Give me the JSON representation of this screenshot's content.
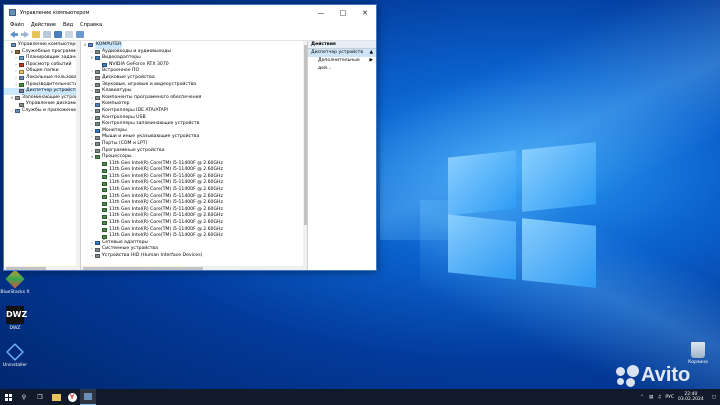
{
  "window": {
    "title": "Управление компьютером",
    "menu": [
      "Файл",
      "Действие",
      "Вид",
      "Справка"
    ]
  },
  "left_tree": [
    {
      "label": "Управление компьютером (л",
      "indent": 0,
      "twisty": "",
      "icon": "computer-mgmt-icon",
      "color": "#6a8fb8"
    },
    {
      "label": "Служебные программы",
      "indent": 1,
      "twisty": "v",
      "icon": "tools-icon",
      "color": "#8a6a48"
    },
    {
      "label": "Планировщик заданий",
      "indent": 2,
      "twisty": ">",
      "icon": "scheduler-icon",
      "color": "#5a9bd0"
    },
    {
      "label": "Просмотр событий",
      "indent": 2,
      "twisty": ">",
      "icon": "event-viewer-icon",
      "color": "#c0392b"
    },
    {
      "label": "Общие папки",
      "indent": 2,
      "twisty": ">",
      "icon": "folder-icon",
      "color": "#e8c25a"
    },
    {
      "label": "Локальные пользоват",
      "indent": 2,
      "twisty": ">",
      "icon": "users-icon",
      "color": "#6a8fb8"
    },
    {
      "label": "Производительность",
      "indent": 2,
      "twisty": ">",
      "icon": "performance-icon",
      "color": "#4b8f3a"
    },
    {
      "label": "Диспетчер устройств",
      "indent": 2,
      "twisty": "",
      "icon": "device-manager-icon",
      "color": "#7a7a9a",
      "selected": true
    },
    {
      "label": "Запоминающие устройст",
      "indent": 1,
      "twisty": "v",
      "icon": "storage-icon",
      "color": "#8c8c8c"
    },
    {
      "label": "Управление дисками",
      "indent": 2,
      "twisty": "",
      "icon": "disk-icon",
      "color": "#8c8c8c"
    },
    {
      "label": "Службы и приложения",
      "indent": 1,
      "twisty": ">",
      "icon": "services-icon",
      "color": "#6a8fb8"
    }
  ],
  "device_tree": [
    {
      "label": "KOMPUTER",
      "indent": 0,
      "twisty": "v",
      "icon": "computer-icon",
      "color": "#5b85c0",
      "highlight": true
    },
    {
      "label": "Аудиовходы и аудиовыходы",
      "indent": 1,
      "twisty": ">",
      "icon": "audio-icon",
      "color": "#7f8c8d"
    },
    {
      "label": "Видеоадаптеры",
      "indent": 1,
      "twisty": "v",
      "icon": "display-adapter-icon",
      "color": "#3d7dbf"
    },
    {
      "label": "NVIDIA GeForce RTX 3070",
      "indent": 2,
      "twisty": "",
      "icon": "display-adapter-icon",
      "color": "#3d7dbf"
    },
    {
      "label": "Встроенное ПО",
      "indent": 1,
      "twisty": ">",
      "icon": "firmware-icon",
      "color": "#7f8c8d"
    },
    {
      "label": "Дисковые устройства",
      "indent": 1,
      "twisty": ">",
      "icon": "disk-icon",
      "color": "#8c8c8c"
    },
    {
      "label": "Звуковые, игровые и видеоустройства",
      "indent": 1,
      "twisty": ">",
      "icon": "sound-icon",
      "color": "#7f8c8d"
    },
    {
      "label": "Клавиатуры",
      "indent": 1,
      "twisty": ">",
      "icon": "keyboard-icon",
      "color": "#7f8c8d"
    },
    {
      "label": "Компоненты программного обеспечения",
      "indent": 1,
      "twisty": ">",
      "icon": "software-icon",
      "color": "#7f8c8d"
    },
    {
      "label": "Компьютер",
      "indent": 1,
      "twisty": ">",
      "icon": "computer-icon",
      "color": "#5b85c0"
    },
    {
      "label": "Контроллеры IDE ATA/ATAPI",
      "indent": 1,
      "twisty": ">",
      "icon": "controller-icon",
      "color": "#7f8c8d"
    },
    {
      "label": "Контроллеры USB",
      "indent": 1,
      "twisty": ">",
      "icon": "usb-icon",
      "color": "#7f8c8d"
    },
    {
      "label": "Контроллеры запоминающих устройств",
      "indent": 1,
      "twisty": ">",
      "icon": "storage-controller-icon",
      "color": "#7f8c8d"
    },
    {
      "label": "Мониторы",
      "indent": 1,
      "twisty": ">",
      "icon": "monitor-icon",
      "color": "#3d7dbf"
    },
    {
      "label": "Мыши и иные указывающие устройства",
      "indent": 1,
      "twisty": ">",
      "icon": "mouse-icon",
      "color": "#7f8c8d"
    },
    {
      "label": "Порты (COM и LPT)",
      "indent": 1,
      "twisty": ">",
      "icon": "ports-icon",
      "color": "#7f8c8d"
    },
    {
      "label": "Программные устройства",
      "indent": 1,
      "twisty": ">",
      "icon": "software-device-icon",
      "color": "#7f8c8d"
    },
    {
      "label": "Процессоры",
      "indent": 1,
      "twisty": "v",
      "icon": "processor-icon",
      "color": "#4c8a4c"
    },
    {
      "label": "11th Gen Intel(R) Core(TM) i5-11400F @ 2.60GHz",
      "indent": 2,
      "twisty": "",
      "icon": "processor-icon",
      "color": "#4c8a4c"
    },
    {
      "label": "11th Gen Intel(R) Core(TM) i5-11400F @ 2.60GHz",
      "indent": 2,
      "twisty": "",
      "icon": "processor-icon",
      "color": "#4c8a4c"
    },
    {
      "label": "11th Gen Intel(R) Core(TM) i5-11400F @ 2.60GHz",
      "indent": 2,
      "twisty": "",
      "icon": "processor-icon",
      "color": "#4c8a4c"
    },
    {
      "label": "11th Gen Intel(R) Core(TM) i5-11400F @ 2.60GHz",
      "indent": 2,
      "twisty": "",
      "icon": "processor-icon",
      "color": "#4c8a4c"
    },
    {
      "label": "11th Gen Intel(R) Core(TM) i5-11400F @ 2.60GHz",
      "indent": 2,
      "twisty": "",
      "icon": "processor-icon",
      "color": "#4c8a4c"
    },
    {
      "label": "11th Gen Intel(R) Core(TM) i5-11400F @ 2.60GHz",
      "indent": 2,
      "twisty": "",
      "icon": "processor-icon",
      "color": "#4c8a4c"
    },
    {
      "label": "11th Gen Intel(R) Core(TM) i5-11400F @ 2.60GHz",
      "indent": 2,
      "twisty": "",
      "icon": "processor-icon",
      "color": "#4c8a4c"
    },
    {
      "label": "11th Gen Intel(R) Core(TM) i5-11400F @ 2.60GHz",
      "indent": 2,
      "twisty": "",
      "icon": "processor-icon",
      "color": "#4c8a4c"
    },
    {
      "label": "11th Gen Intel(R) Core(TM) i5-11400F @ 2.60GHz",
      "indent": 2,
      "twisty": "",
      "icon": "processor-icon",
      "color": "#4c8a4c"
    },
    {
      "label": "11th Gen Intel(R) Core(TM) i5-11400F @ 2.60GHz",
      "indent": 2,
      "twisty": "",
      "icon": "processor-icon",
      "color": "#4c8a4c"
    },
    {
      "label": "11th Gen Intel(R) Core(TM) i5-11400F @ 2.60GHz",
      "indent": 2,
      "twisty": "",
      "icon": "processor-icon",
      "color": "#4c8a4c"
    },
    {
      "label": "11th Gen Intel(R) Core(TM) i5-11400F @ 2.60GHz",
      "indent": 2,
      "twisty": "",
      "icon": "processor-icon",
      "color": "#4c8a4c"
    },
    {
      "label": "Сетевые адаптеры",
      "indent": 1,
      "twisty": ">",
      "icon": "network-icon",
      "color": "#3d7dbf"
    },
    {
      "label": "Системные устройства",
      "indent": 1,
      "twisty": ">",
      "icon": "system-device-icon",
      "color": "#7f8c8d"
    },
    {
      "label": "Устройства HID (Human Interface Devices)",
      "indent": 1,
      "twisty": ">",
      "icon": "hid-icon",
      "color": "#7f8c8d"
    }
  ],
  "actions": {
    "header": "Действия",
    "selected": "Диспетчер устройств",
    "more": "Дополнительные дей..."
  },
  "desktop": {
    "icons": [
      {
        "name": "BlueStacks-icon",
        "label": "BlueStacks X"
      },
      {
        "name": "dwz-icon",
        "label": "DWZ"
      },
      {
        "name": "uninstaller-icon",
        "label": "Uninstaller"
      }
    ],
    "recycle_bin": "Корзина"
  },
  "taskbar": {
    "lang": "РУС",
    "time": "22:40",
    "date": "03.02.2024"
  },
  "watermark": "Avito"
}
